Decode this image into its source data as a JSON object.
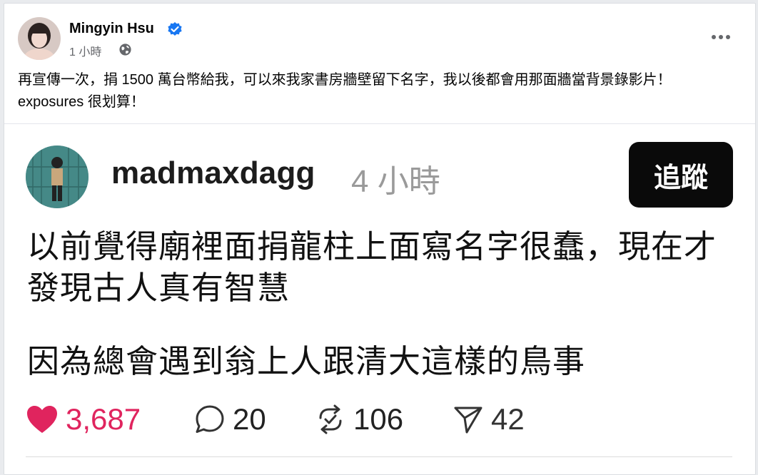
{
  "facebook_post": {
    "author": "Mingyin Hsu",
    "time": "1 小時",
    "text": "再宣傳一次，捐 1500 萬台幣給我，可以來我家書房牆壁留下名字，我以後都會用那面牆當背景錄影片！exposures 很划算！",
    "icons": [
      "verified-badge-icon",
      "globe-icon",
      "more-options-icon"
    ]
  },
  "embedded_threads_post": {
    "username": "madmaxdagg",
    "time": "4 小時",
    "follow_label": "追蹤",
    "paragraph1": "以前覺得廟裡面捐龍柱上面寫名字很蠢，現在才發現古人真有智慧",
    "paragraph2": "因為總會遇到翁上人跟清大這樣的鳥事",
    "stats": {
      "likes": "3,687",
      "replies": "20",
      "reposts": "106",
      "shares": "42"
    },
    "colors": {
      "like": "#e0245e",
      "follow_button_bg": "#0a0a0a"
    }
  }
}
